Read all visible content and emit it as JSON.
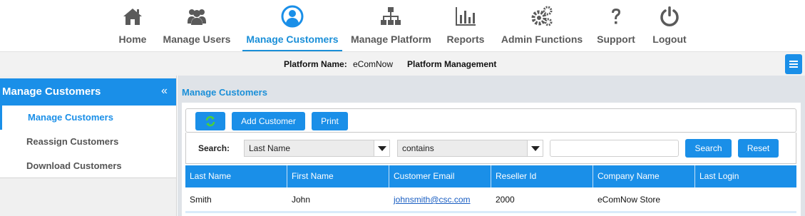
{
  "nav": {
    "items": [
      {
        "label": "Home",
        "icon": "home-icon"
      },
      {
        "label": "Manage Users",
        "icon": "users-icon"
      },
      {
        "label": "Manage Customers",
        "icon": "user-circle-icon",
        "active": true
      },
      {
        "label": "Manage Platform",
        "icon": "sitemap-icon"
      },
      {
        "label": "Reports",
        "icon": "bar-chart-icon"
      },
      {
        "label": "Admin Functions",
        "icon": "gears-icon"
      },
      {
        "label": "Support",
        "icon": "question-icon"
      },
      {
        "label": "Logout",
        "icon": "power-icon"
      }
    ]
  },
  "platform": {
    "label": "Platform Name:",
    "value": "eComNow",
    "section": "Platform Management"
  },
  "sidebar": {
    "title": "Manage Customers",
    "collapse_glyph": "«",
    "items": [
      {
        "label": "Manage Customers",
        "active": true
      },
      {
        "label": "Reassign Customers"
      },
      {
        "label": "Download Customers"
      }
    ]
  },
  "main": {
    "title": "Manage Customers",
    "toolbar": {
      "refresh_icon": "refresh-icon",
      "add_label": "Add Customer",
      "print_label": "Print"
    },
    "search": {
      "label": "Search:",
      "field_value": "Last Name",
      "operator_value": "contains",
      "query_value": "",
      "search_label": "Search",
      "reset_label": "Reset"
    },
    "table": {
      "columns": [
        "Last Name",
        "First Name",
        "Customer Email",
        "Reseller Id",
        "Company Name",
        "Last Login"
      ],
      "rows": [
        {
          "last_name": "Smith",
          "first_name": "John",
          "email": "johnsmith@csc.com",
          "reseller_id": "2000",
          "company": "eComNow Store",
          "last_login": ""
        }
      ]
    }
  },
  "colors": {
    "accent": "#1a8fe8",
    "nav_text": "#5a5a5a",
    "refresh_green": "#4cd137"
  }
}
